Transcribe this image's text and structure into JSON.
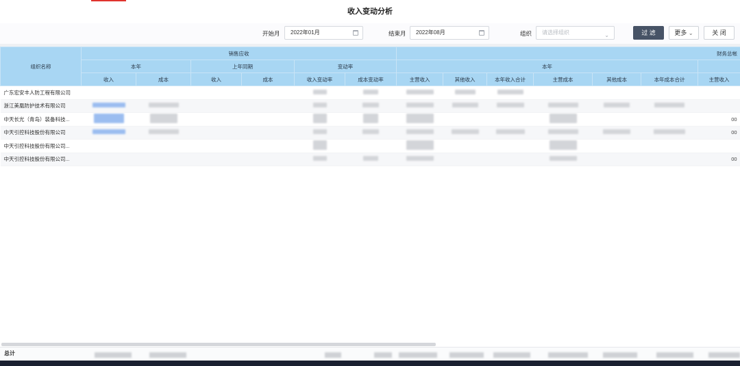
{
  "page": {
    "title": "收入变动分析"
  },
  "filters": {
    "start_label": "开始月",
    "start_value": "2022年01月",
    "end_label": "结束月",
    "end_value": "2022年08月",
    "org_label": "组织",
    "org_placeholder": "请选择组织",
    "filter_button": "过 滤",
    "more_button": "更多",
    "close_button": "关 闭"
  },
  "table": {
    "org_header": "组织名称",
    "group_sales": "销售应收",
    "group_finance": "财务总帐",
    "sub_this_year": "本年",
    "sub_last_year": "上年同期",
    "sub_change_rate": "变动率",
    "sub_this_year_fin": "本年",
    "cols": [
      "收入",
      "成本",
      "收入",
      "成本",
      "收入变动率",
      "成本变动率",
      "主营收入",
      "其他收入",
      "本年收入合计",
      "主营成本",
      "其他成本",
      "本年成本合计",
      "主营收入"
    ],
    "rows": [
      {
        "name": "广东宏安丰人防工程有限公司",
        "trail": ""
      },
      {
        "name": "浙江美凰防护技术有限公司",
        "trail": ""
      },
      {
        "name": "中天长光（青岛）装备科技...",
        "trail": "00"
      },
      {
        "name": "中天引控科技股份有限公司",
        "trail": "00"
      },
      {
        "name": "中天引控科技股份有限公司...",
        "trail": ""
      },
      {
        "name": "中天引控科技股份有限公司...",
        "trail": "00"
      }
    ]
  },
  "footer": {
    "total_label": "总计"
  }
}
